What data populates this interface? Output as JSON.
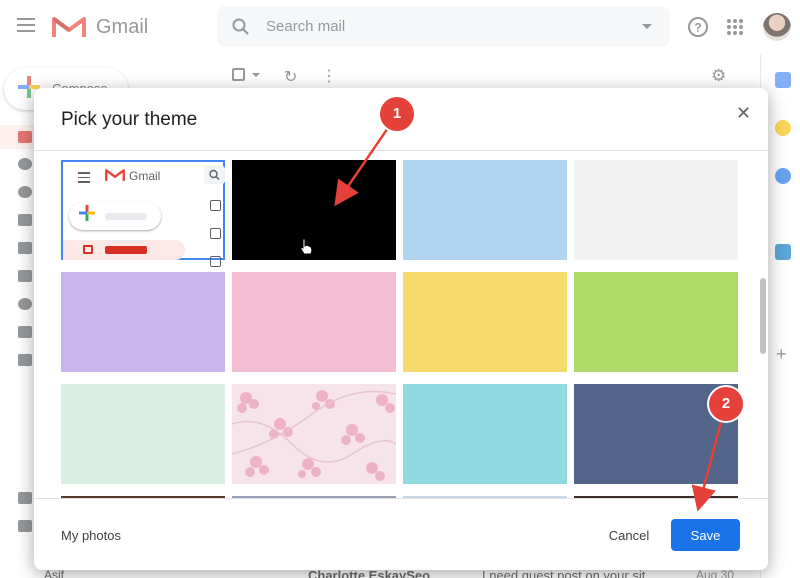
{
  "header": {
    "app_name": "Gmail",
    "search_placeholder": "Search mail"
  },
  "compose": {
    "label": "Compose"
  },
  "inbox_preview_row": {
    "user": "Asif",
    "sender": "Charlotte EskaySeo",
    "subject": "I need guest post on your sit",
    "date": "Aug 30"
  },
  "dialog": {
    "title": "Pick your theme",
    "tiles": [
      {
        "id": "default",
        "color": "#ffffff",
        "preview_text": "Gmail"
      },
      {
        "id": "black",
        "color": "#000000"
      },
      {
        "id": "light-blue",
        "color": "#b1d4ef"
      },
      {
        "id": "light-gray",
        "color": "#f2f2f2"
      },
      {
        "id": "lavender",
        "color": "#c9b5eb"
      },
      {
        "id": "pink",
        "color": "#f4bfd4"
      },
      {
        "id": "yellow",
        "color": "#f6da6e"
      },
      {
        "id": "green",
        "color": "#acd968"
      },
      {
        "id": "mint",
        "color": "#d9efe3"
      },
      {
        "id": "cherry-blossom",
        "color": "#f7e3ea"
      },
      {
        "id": "turquoise",
        "color": "#8fdbe0"
      },
      {
        "id": "slate-blue",
        "color": "#536588"
      }
    ],
    "my_photos_label": "My photos",
    "cancel_label": "Cancel",
    "save_label": "Save"
  },
  "annotations": [
    {
      "label": "1"
    },
    {
      "label": "2"
    }
  ]
}
